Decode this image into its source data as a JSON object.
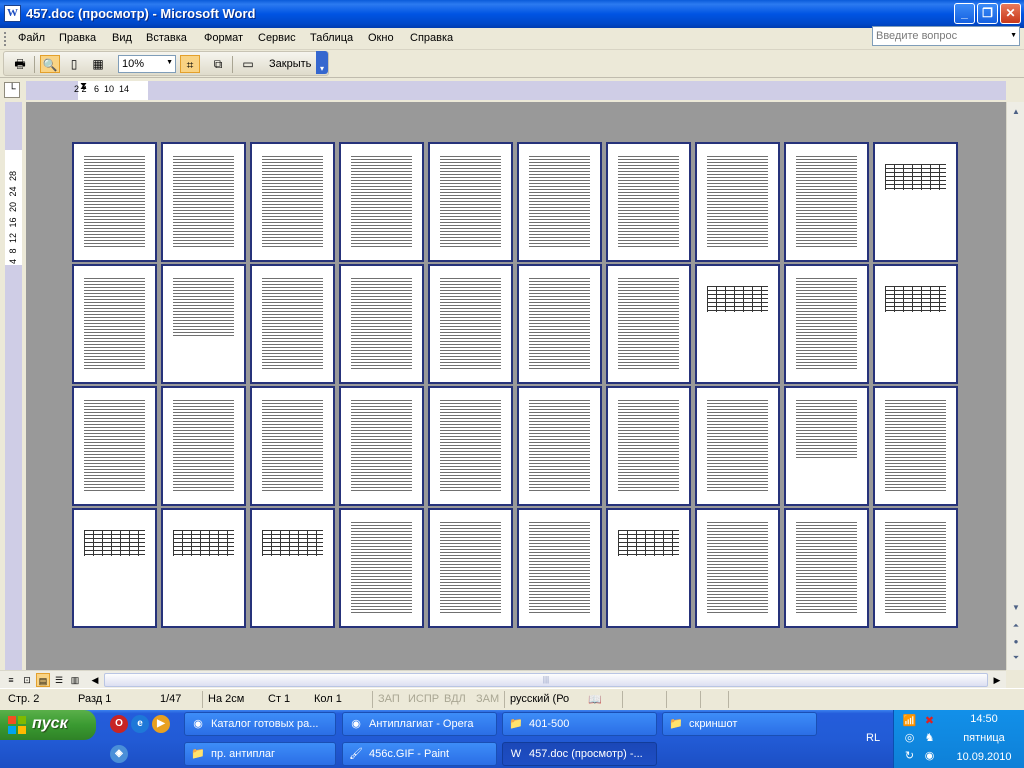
{
  "window": {
    "title": "457.doc (просмотр) - Microsoft Word",
    "icon": "W"
  },
  "menu": [
    "Файл",
    "Правка",
    "Вид",
    "Вставка",
    "Формат",
    "Сервис",
    "Таблица",
    "Окно",
    "Справка"
  ],
  "help_box": {
    "placeholder": "Введите вопрос"
  },
  "toolbar": {
    "zoom": "10%",
    "close_label": "Закрыть"
  },
  "ruler": {
    "numbers": "2 2   6  10  14",
    "vertical_numbers": "4 8 12 16 20 24 28"
  },
  "document": {
    "page_count": 40,
    "rows": 4,
    "columns": 10,
    "table_pages": [
      10,
      18,
      20,
      31,
      32,
      33,
      37
    ],
    "short_pages": [
      29,
      12
    ]
  },
  "status": {
    "page": "Стр. 2",
    "section": "Разд 1",
    "pages": "1/47",
    "at": "На 2см",
    "line": "Ст 1",
    "column": "Кол 1",
    "rec": "ЗАП",
    "trk": "ИСПР",
    "ext": "ВДЛ",
    "ovr": "ЗАМ",
    "language": "русский (Ро"
  },
  "taskbar": {
    "start_label": "пуск",
    "tasks_row1": [
      "Каталог готовых ра...",
      "Антиплагиат - Opera",
      "401-500",
      "скриншот"
    ],
    "tasks_row2": [
      "пр. антиплаг",
      "456c.GIF - Paint",
      "457.doc (просмотр) -..."
    ],
    "language": "RL",
    "clock": {
      "time": "14:50",
      "day": "пятница",
      "date": "10.09.2010"
    }
  },
  "colors": {
    "titlebar": "#0054e3",
    "taskbar": "#245ddb",
    "start": "#3a9a31",
    "page_border": "#26327a",
    "doc_bg": "#999999"
  },
  "icons": {
    "window_controls": [
      "minimize-icon",
      "maximize-icon",
      "close-icon"
    ],
    "toolbar": [
      "print-icon",
      "magnifier-icon",
      "one-page-icon",
      "multiple-pages-icon",
      "full-screen-icon",
      "shrink-to-fit-icon",
      "view-ruler-icon"
    ],
    "view_buttons": [
      "normal-view-icon",
      "web-view-icon",
      "print-layout-icon",
      "outline-view-icon",
      "reading-view-icon"
    ]
  }
}
